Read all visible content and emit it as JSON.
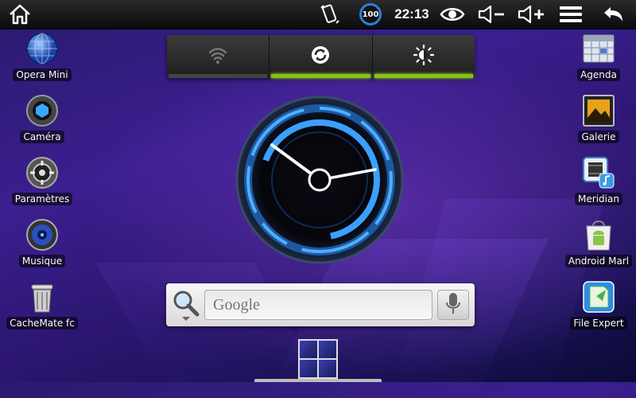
{
  "status_bar": {
    "home_icon": "home-icon",
    "screen_icon": "screen-rotate-icon",
    "battery_level": "100",
    "time": "22:13",
    "eye_icon": "eye-icon",
    "volume_down_icon": "volume-down-icon",
    "volume_up_icon": "volume-up-icon",
    "menu_icon": "menu-icon",
    "back_icon": "back-icon"
  },
  "left_apps": [
    {
      "label": "Opera Mini",
      "icon": "globe-icon"
    },
    {
      "label": "Caméra",
      "icon": "camera-icon"
    },
    {
      "label": "Paramètres",
      "icon": "settings-icon"
    },
    {
      "label": "Musique",
      "icon": "music-icon"
    },
    {
      "label": "CacheMate fc",
      "icon": "trash-icon"
    }
  ],
  "right_apps": [
    {
      "label": "Agenda",
      "icon": "calendar-icon"
    },
    {
      "label": "Galerie",
      "icon": "gallery-icon"
    },
    {
      "label": "Meridian",
      "icon": "media-icon"
    },
    {
      "label": "Android Marl",
      "icon": "market-icon"
    },
    {
      "label": "File Expert",
      "icon": "file-icon"
    }
  ],
  "power_widget": {
    "buttons": [
      {
        "icon": "wifi-icon",
        "enabled": false
      },
      {
        "icon": "sync-icon",
        "enabled": true
      },
      {
        "icon": "brightness-icon",
        "enabled": true
      }
    ]
  },
  "search": {
    "placeholder": "Google",
    "search_icon": "magnifier-icon",
    "mic_icon": "microphone-icon"
  },
  "colors": {
    "accent_green": "#86c11a",
    "clock_blue": "#3aa0ff",
    "battery_blue": "#2c7fd8"
  }
}
